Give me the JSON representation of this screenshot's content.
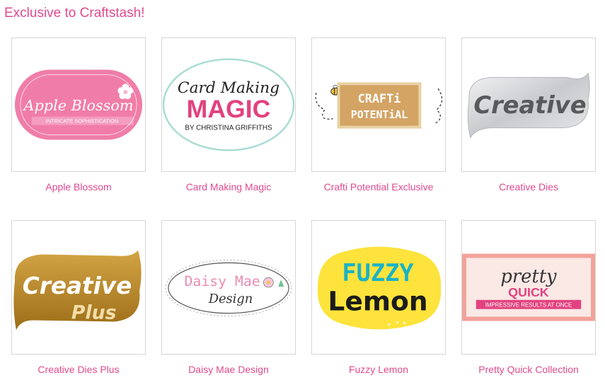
{
  "page": {
    "heading": "Exclusive to Craftstash!"
  },
  "brands": [
    {
      "name": "Apple Blossom",
      "logo": {
        "line1": "Apple Blossom",
        "line2": "INTRICATE SOPHISTICATION"
      },
      "colors": {
        "primary": "#f07da8"
      }
    },
    {
      "name": "Card Making Magic",
      "logo": {
        "line1": "Card Making",
        "line2": "MAGIC",
        "line3": "BY CHRISTINA GRIFFITHS"
      },
      "colors": {
        "primary": "#e2427f",
        "ring": "#a9dcd3"
      }
    },
    {
      "name": "Crafti Potential Exclusive",
      "logo": {
        "line1": "CRAFTi",
        "line2": "POTENTiAL"
      },
      "colors": {
        "primary": "#d4a465"
      }
    },
    {
      "name": "Creative Dies",
      "logo": {
        "line1": "Creative"
      },
      "colors": {
        "primary": "#d9dadd"
      }
    },
    {
      "name": "Creative Dies Plus",
      "logo": {
        "line1": "Creative",
        "line2": "Plus"
      },
      "colors": {
        "primary": "#b98526"
      }
    },
    {
      "name": "Daisy Mae Design",
      "logo": {
        "line1": "Daisy Mae",
        "line2": "Design"
      },
      "colors": {
        "primary": "#f28cb2"
      }
    },
    {
      "name": "Fuzzy Lemon",
      "logo": {
        "line1": "FUZZY",
        "line2": "Lemon"
      },
      "colors": {
        "primary": "#fde33c",
        "accent": "#1ab3c8"
      }
    },
    {
      "name": "Pretty Quick Collection",
      "logo": {
        "line1": "pretty",
        "line2": "QUICK",
        "line3": "IMPRESSIVE RESULTS AT ONCE"
      },
      "colors": {
        "primary": "#f2a39a",
        "accent": "#e2427f"
      }
    }
  ]
}
